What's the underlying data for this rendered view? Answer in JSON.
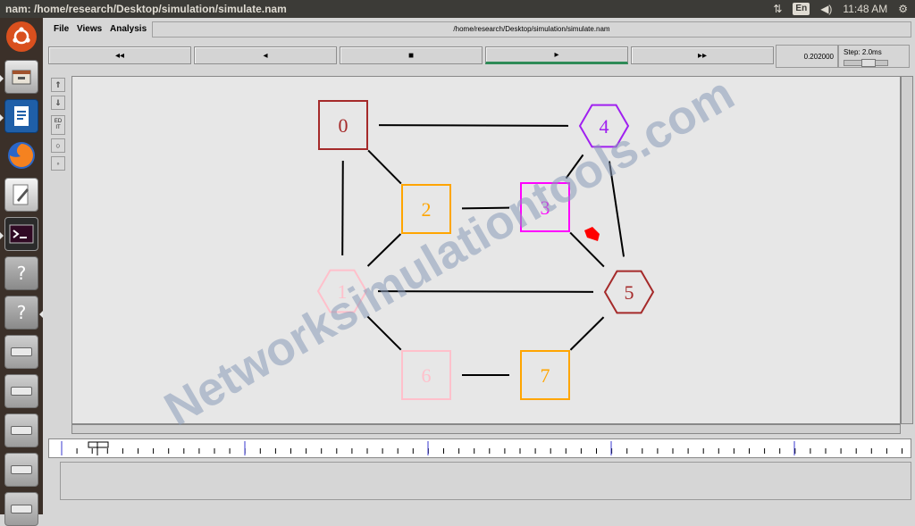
{
  "topbar": {
    "title": "nam: /home/research/Desktop/simulation/simulate.nam",
    "keyboard": "En",
    "clock": "11:48 AM",
    "network_icon": "network-arrows-icon",
    "volume_icon": "speaker-icon",
    "power_icon": "power-gear-icon"
  },
  "menu": {
    "file": "File",
    "views": "Views",
    "analysis": "Analysis",
    "path": "/home/research/Desktop/simulation/simulate.nam"
  },
  "controls": {
    "rewind": "◂◂",
    "back": "◂",
    "stop": "■",
    "play": "▸",
    "fast_forward": "▸▸",
    "time": "0.202000",
    "step": "Step: 2.0ms"
  },
  "tools": {
    "edit": "ED IT"
  },
  "network": {
    "nodes": [
      {
        "id": "0",
        "label": "0",
        "shape": "square",
        "color": "#a52a2a"
      },
      {
        "id": "1",
        "label": "1",
        "shape": "hexagon",
        "color": "#ffc0cb"
      },
      {
        "id": "2",
        "label": "2",
        "shape": "square",
        "color": "#ffa500"
      },
      {
        "id": "3",
        "label": "3",
        "shape": "square",
        "color": "#ff00ff"
      },
      {
        "id": "4",
        "label": "4",
        "shape": "hexagon",
        "color": "#a020f0"
      },
      {
        "id": "5",
        "label": "5",
        "shape": "hexagon",
        "color": "#a52a2a"
      },
      {
        "id": "6",
        "label": "6",
        "shape": "square",
        "color": "#ffc0cb"
      },
      {
        "id": "7",
        "label": "7",
        "shape": "square",
        "color": "#ffa500"
      }
    ],
    "links": [
      [
        "0",
        "4"
      ],
      [
        "0",
        "2"
      ],
      [
        "0",
        "1"
      ],
      [
        "2",
        "3"
      ],
      [
        "2",
        "1"
      ],
      [
        "3",
        "4"
      ],
      [
        "3",
        "5"
      ],
      [
        "4",
        "5"
      ],
      [
        "1",
        "5"
      ],
      [
        "1",
        "6"
      ],
      [
        "6",
        "7"
      ],
      [
        "7",
        "5"
      ]
    ],
    "packet_color": "#ff0000"
  },
  "watermark": {
    "text": "Networksimulationtools.com",
    "color": "#8a9bb8"
  },
  "launcher": {
    "items": [
      {
        "name": "ubuntu-logo-icon"
      },
      {
        "name": "files-icon"
      },
      {
        "name": "writer-icon"
      },
      {
        "name": "firefox-icon"
      },
      {
        "name": "text-editor-icon"
      },
      {
        "name": "terminal-icon"
      },
      {
        "name": "unknown-app-icon",
        "glyph": "?"
      },
      {
        "name": "unknown-app-icon",
        "glyph": "?"
      },
      {
        "name": "drive-icon"
      },
      {
        "name": "drive-icon"
      },
      {
        "name": "drive-icon"
      },
      {
        "name": "drive-icon"
      },
      {
        "name": "drive-icon"
      }
    ]
  }
}
